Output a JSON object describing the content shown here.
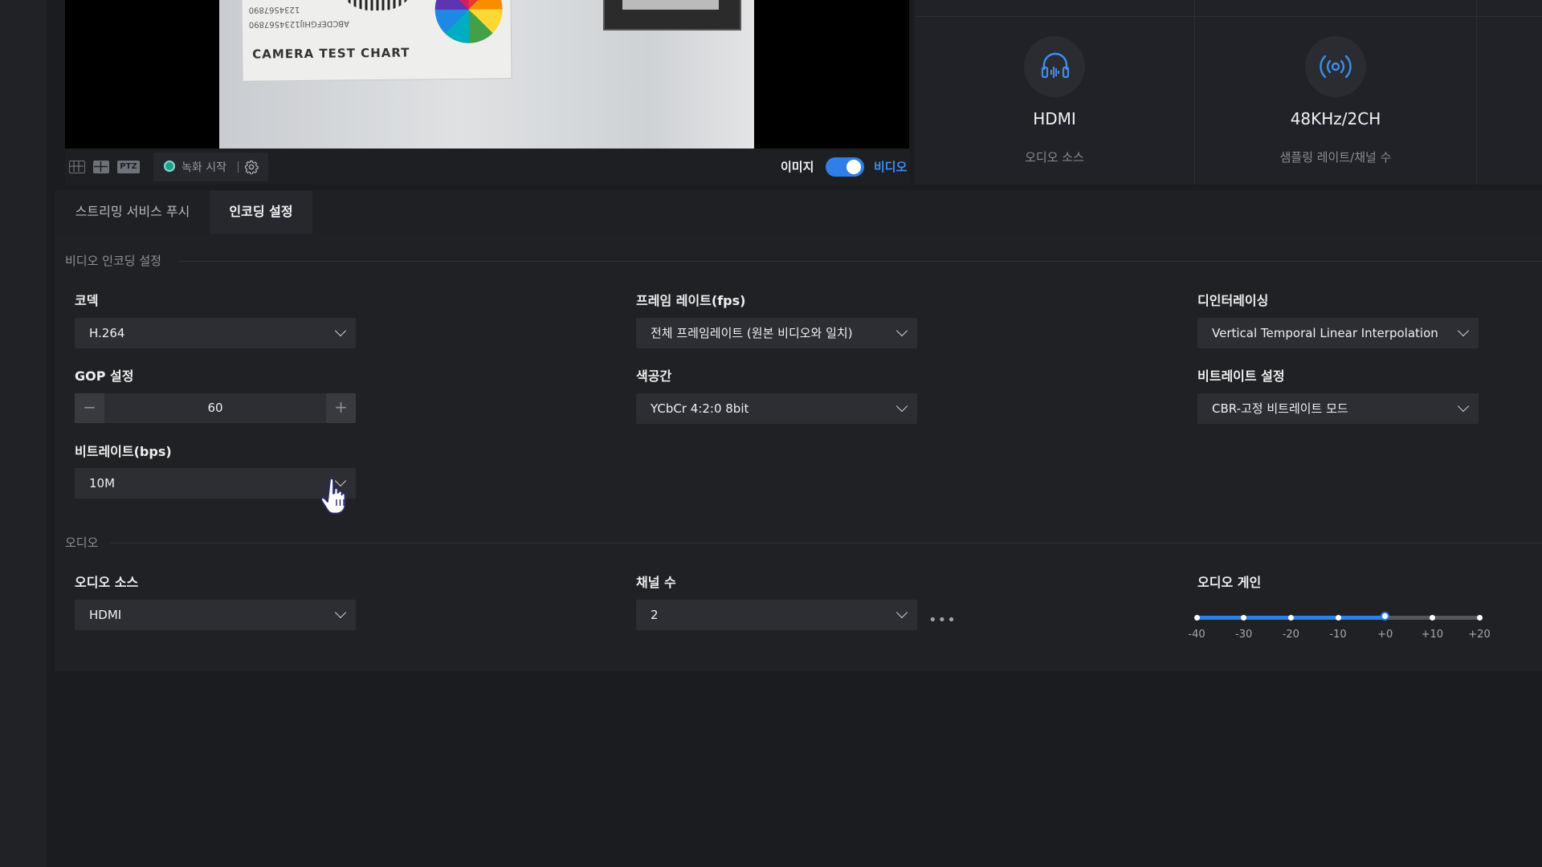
{
  "preview": {
    "chart_caption": "CAMERA TEST CHART",
    "chart_digits": "1234567890",
    "chart_letters": "ABCDEFGHIJ1234567890"
  },
  "video_toolbar": {
    "ptz_label": "PTZ",
    "record_label": "녹화 시작",
    "image_label": "이미지",
    "video_label": "비디오",
    "toggle_on": true
  },
  "audio_status": {
    "source_value": "HDMI",
    "source_caption": "오디오 소스",
    "rate_value": "48KHz/2CH",
    "rate_caption": "샘플링 레이트/채널 수"
  },
  "tabs": [
    {
      "label": "스트리밍 서비스 푸시",
      "active": false
    },
    {
      "label": "인코딩 설정",
      "active": true
    }
  ],
  "video_encoding": {
    "section_title": "비디오 인코딩 설정",
    "codec": {
      "label": "코덱",
      "value": "H.264"
    },
    "frame_rate": {
      "label": "프레임 레이트(fps)",
      "value": "전체 프레임레이트 (원본 비디오와 일치)"
    },
    "deinterlace": {
      "label": "디인터레이싱",
      "value": "Vertical Temporal Linear Interpolation"
    },
    "gop": {
      "label": "GOP 설정",
      "value": "60",
      "minus": "−",
      "plus": "+"
    },
    "color_space": {
      "label": "색공간",
      "value": "YCbCr 4:2:0 8bit"
    },
    "bitrate_mode": {
      "label": "비트레이트 설정",
      "value": "CBR-고정 비트레이트 모드"
    },
    "bitrate": {
      "label": "비트레이트(bps)",
      "value": "10M"
    }
  },
  "audio": {
    "section_title": "오디오",
    "source": {
      "label": "오디오 소스",
      "value": "HDMI"
    },
    "channels": {
      "label": "채널 수",
      "value": "2",
      "more": "•••"
    },
    "gain": {
      "label": "오디오 게인",
      "ticks": [
        "-40",
        "-30",
        "-20",
        "-10",
        "+0",
        "+10",
        "+20"
      ],
      "value_index": 4
    }
  },
  "colors": {
    "accent": "#2f7fe6",
    "background": "#1b1c1f",
    "panel": "#202125",
    "field": "#2c2e33"
  },
  "icons": [
    "headphones-icon",
    "broadcast-icon",
    "layout-single-icon",
    "layout-grid-icon",
    "record-dot-icon",
    "gear-icon",
    "chevron-down-icon",
    "minus-icon",
    "plus-icon",
    "more-icon",
    "hand-cursor-icon"
  ]
}
